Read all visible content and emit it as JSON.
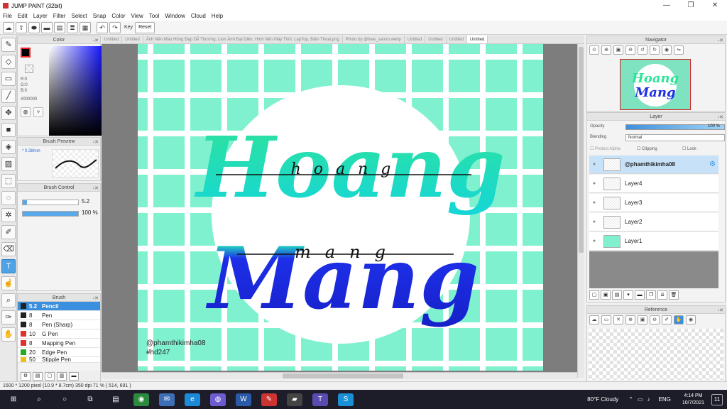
{
  "window": {
    "title": "JUMP PAINT (32bit)",
    "min": "—",
    "max": "❐",
    "close": "✕"
  },
  "menu": [
    "File",
    "Edit",
    "Layer",
    "Filter",
    "Select",
    "Snap",
    "Color",
    "View",
    "Tool",
    "Window",
    "Cloud",
    "Help"
  ],
  "toolbar": {
    "key_label": "Key",
    "reset_label": "Reset"
  },
  "color_panel": {
    "title": "Color",
    "r": "R:0",
    "g": "G:0",
    "b": "B:0",
    "hex": "#000000"
  },
  "brush_preview": {
    "title": "Brush Preview",
    "size": "* 0.38mm"
  },
  "brush_control": {
    "title": "Brush Control",
    "size_value": "5.2",
    "opacity_value": "100 %"
  },
  "brush": {
    "title": "Brush",
    "items": [
      {
        "size": "5.2",
        "name": "Pencil",
        "color": "#222222"
      },
      {
        "size": "8",
        "name": "Pen",
        "color": "#222222"
      },
      {
        "size": "8",
        "name": "Pen (Sharp)",
        "color": "#222222"
      },
      {
        "size": "10",
        "name": "G Pen",
        "color": "#e03030"
      },
      {
        "size": "8",
        "name": "Mapping Pen",
        "color": "#e03030"
      },
      {
        "size": "20",
        "name": "Edge Pen",
        "color": "#22aa22"
      },
      {
        "size": "50",
        "name": "Stipple Pen",
        "color": "#e8c020"
      }
    ]
  },
  "tabs": [
    "Untitled",
    "Untitled",
    "Ảnh Nền Màu Hồng Đẹp Dễ Thương, Làm Ảnh Đại Diện, Hình Nền Máy Tính, LapTop, Điện Thoại.png",
    "Photo by @love_sanrio.webp",
    "Untitled",
    "Untitled",
    "Untitled",
    "Untitled"
  ],
  "canvas": {
    "word1": "Hoang",
    "word2": "Mang",
    "sketch1": "hoang",
    "sketch2": "mang",
    "credit1": "@phamthikimha08",
    "credit2": "#hd247",
    "bg_color": "#7ff1cf",
    "circle_color": "#ffffff",
    "word1_colors": [
      "#2fe39a",
      "#14d6d8"
    ],
    "word2_colors": [
      "#20c7c3",
      "#1d2fe8"
    ]
  },
  "statusbar": "1500 * 1200 pixel  (10.9 * 8.7cm)  350 dpi  71 %  ( 514, 691 )",
  "navigator": {
    "title": "Navigator"
  },
  "layer_panel": {
    "title": "Layer",
    "opacity_label": "Opacity",
    "opacity_value": "100 %",
    "blending_label": "Blending",
    "blending_value": "Normal",
    "protect_alpha": "Protect Alpha",
    "clipping": "Clipping",
    "lock": "Lock",
    "layers": [
      "@phamthikimha08",
      "Layer4",
      "Layer3",
      "Layer2",
      "Layer1"
    ]
  },
  "reference": {
    "title": "Reference"
  },
  "taskbar": {
    "weather": "80°F  Cloudy",
    "time": "4:14 PM",
    "date": "10/7/2021",
    "lang": "ENG",
    "notif": "11"
  }
}
